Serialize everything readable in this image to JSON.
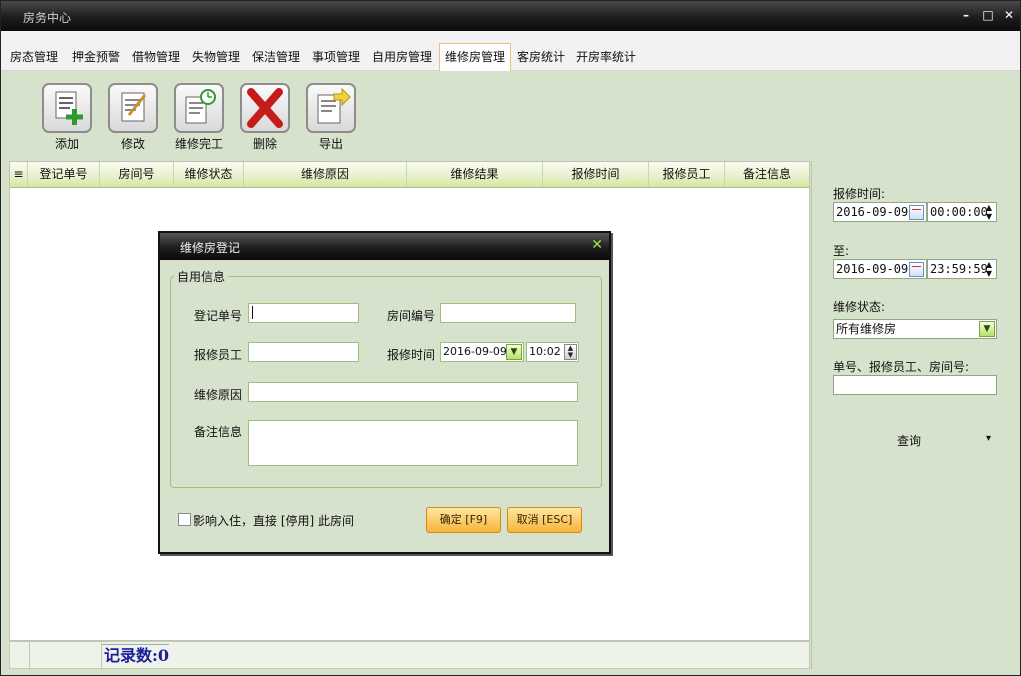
{
  "window": {
    "title": "房务中心",
    "minimize": "–",
    "maximize": "□",
    "close": "✕"
  },
  "menu": [
    {
      "id": "room-status",
      "label": "房态管理"
    },
    {
      "id": "deposit-alert",
      "label": "押金预警"
    },
    {
      "id": "borrow",
      "label": "借物管理"
    },
    {
      "id": "lost",
      "label": "失物管理"
    },
    {
      "id": "cleaning",
      "label": "保洁管理"
    },
    {
      "id": "matters",
      "label": "事项管理"
    },
    {
      "id": "self-use",
      "label": "自用房管理"
    },
    {
      "id": "maintenance",
      "label": "维修房管理"
    },
    {
      "id": "guest-stats",
      "label": "客房统计"
    },
    {
      "id": "occupancy-stats",
      "label": "开房率统计"
    }
  ],
  "active_tab": "maintenance",
  "toolbar": {
    "add": "添加",
    "edit": "修改",
    "complete": "维修完工",
    "delete": "删除",
    "export": "导出"
  },
  "grid": {
    "columns": [
      "登记单号",
      "房间号",
      "维修状态",
      "维修原因",
      "维修结果",
      "报修时间",
      "报修员工",
      "备注信息"
    ],
    "rows": []
  },
  "status": {
    "record_count": "记录数:0"
  },
  "sidebar": {
    "time_label": "报修时间:",
    "from_date": "2016-09-09",
    "from_time": "00:00:00",
    "to_label": "至:",
    "to_date": "2016-09-09",
    "to_time": "23:59:59",
    "status_label": "维修状态:",
    "status_value": "所有维修房",
    "search_label": "单号、报修员工、房间号:",
    "search_value": "",
    "query_button": "查询",
    "query_arrow": "▾"
  },
  "dialog": {
    "title": "维修房登记",
    "close": "✕",
    "group_label": "自用信息",
    "order_no_label": "登记单号",
    "order_no_value": "",
    "room_no_label": "房间编号",
    "room_no_value": "",
    "staff_label": "报修员工",
    "staff_value": "",
    "time_label": "报修时间",
    "date_value": "2016-09-09",
    "time_value": "10:02",
    "reason_label": "维修原因",
    "reason_value": "",
    "remark_label": "备注信息",
    "remark_value": "",
    "checkbox_label": "影响入住，直接 [停用] 此房间",
    "ok_button": "确定 [F9]",
    "cancel_button": "取消 [ESC]"
  },
  "colors": {
    "panel": "#d6e2cb",
    "title_bar": "#1d1d1d",
    "header_green": "#d4e6a0",
    "button_orange": "#f7b43a",
    "record_count_text": "#1b1f9a"
  }
}
